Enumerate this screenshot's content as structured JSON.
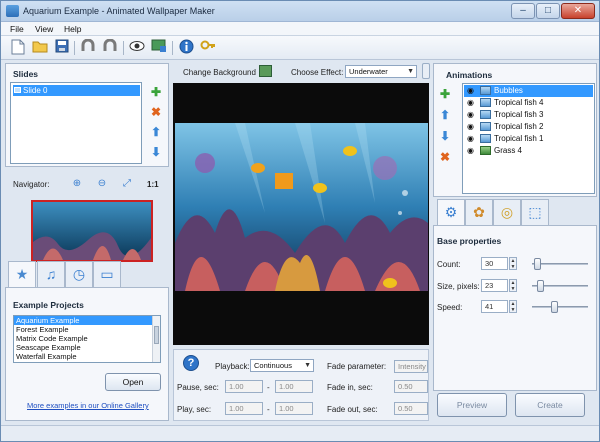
{
  "window": {
    "title": "Aquarium Example - Animated Wallpaper Maker",
    "minimize": "–",
    "maximize": "□",
    "close": "✕"
  },
  "menu": [
    "File",
    "View",
    "Help"
  ],
  "toolbar": {
    "icons": [
      "new-document-icon",
      "open-folder-icon",
      "save-icon",
      "undo-icon",
      "redo-icon",
      "preview-eye-icon",
      "wallpaper-icon",
      "info-icon",
      "key-icon"
    ]
  },
  "slides": {
    "title": "Slides",
    "items": [
      "Slide 0"
    ]
  },
  "navigator": {
    "label": "Navigator:",
    "zoom": "1:1"
  },
  "examples": {
    "title": "Example Projects",
    "items": [
      "Aquarium Example",
      "Forest Example",
      "Matrix Code Example",
      "Seascape Example",
      "Waterfall Example"
    ],
    "open_label": "Open",
    "gallery_link": "More examples in our Online Gallery"
  },
  "center": {
    "change_background": "Change Background",
    "choose_effect_label": "Choose Effect:",
    "effect_value": "Underwater"
  },
  "playback": {
    "label": "Playback:",
    "value": "Continuous",
    "pause_label": "Pause, sec:",
    "pause_from": "1.00",
    "pause_to": "1.00",
    "play_label": "Play, sec:",
    "play_from": "1.00",
    "play_to": "1.00",
    "dash": "-",
    "fade_param_label": "Fade parameter:",
    "fade_param_value": "Intensity",
    "fade_in_label": "Fade in, sec:",
    "fade_in_value": "0.50",
    "fade_out_label": "Fade out, sec:",
    "fade_out_value": "0.50"
  },
  "animations": {
    "title": "Animations",
    "items": [
      "Bubbles",
      "Tropical fish 4",
      "Tropical fish 3",
      "Tropical fish 2",
      "Tropical fish 1",
      "Grass 4"
    ]
  },
  "base_properties": {
    "title": "Base properties",
    "count_label": "Count:",
    "count_value": "30",
    "count_level": 0.05,
    "size_label": "Size, pixels:",
    "size_value": "23",
    "size_level": 0.1,
    "speed_label": "Speed:",
    "speed_value": "41",
    "speed_level": 0.38
  },
  "bottom_buttons": {
    "preview": "Preview",
    "create": "Create"
  },
  "colors": {
    "accent": "#3399ff",
    "window_bg": "#dfe7f1",
    "add": "#3aa33a",
    "remove": "#e0641e",
    "move": "#3a87d6"
  }
}
